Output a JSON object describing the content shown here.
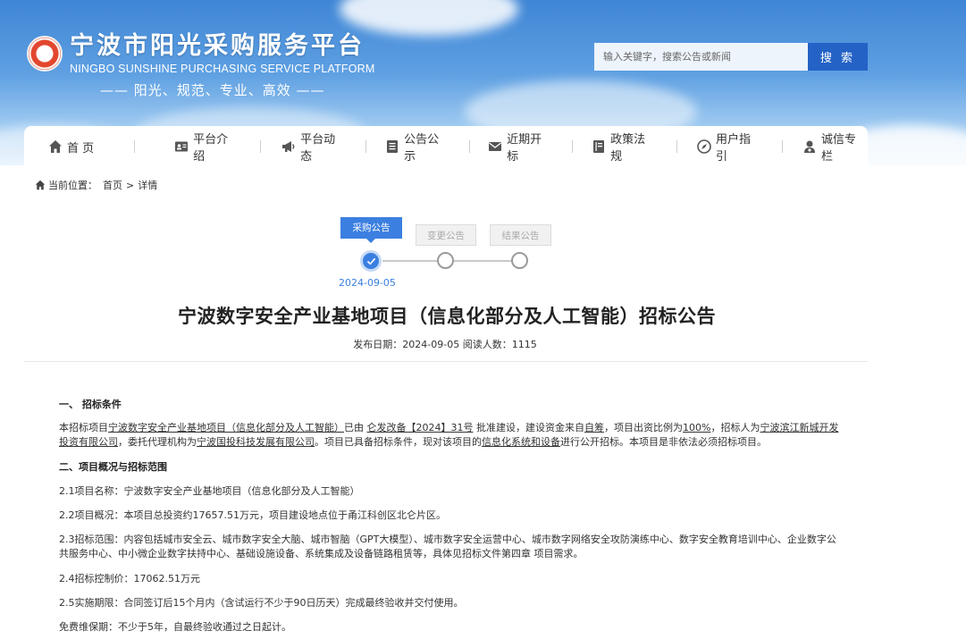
{
  "header": {
    "logo_cn": "宁波市阳光采购服务平台",
    "logo_en": "NINGBO SUNSHINE PURCHASING SERVICE PLATFORM",
    "slogan": "—— 阳光、规范、专业、高效 ——",
    "search": {
      "placeholder": "输入关键字，搜索公告或新闻",
      "button": "搜 索"
    }
  },
  "nav": {
    "items": [
      {
        "label": "首 页",
        "icon": "home-icon"
      },
      {
        "label": "平台介绍",
        "icon": "id-card-icon"
      },
      {
        "label": "平台动态",
        "icon": "megaphone-icon"
      },
      {
        "label": "公告公示",
        "icon": "list-doc-icon"
      },
      {
        "label": "近期开标",
        "icon": "envelope-icon"
      },
      {
        "label": "政策法规",
        "icon": "book-icon"
      },
      {
        "label": "用户指引",
        "icon": "compass-icon"
      },
      {
        "label": "诚信专栏",
        "icon": "person-badge-icon"
      }
    ]
  },
  "breadcrumb": {
    "prefix": "当前位置：",
    "home": "首页",
    "sep": ">",
    "current": "详情"
  },
  "steps": [
    {
      "label": "采购公告",
      "state": "active",
      "date": "2024-09-05"
    },
    {
      "label": "变更公告",
      "state": "inactive"
    },
    {
      "label": "结果公告",
      "state": "inactive"
    }
  ],
  "article": {
    "title": "宁波数字安全产业基地项目（信息化部分及人工智能）招标公告",
    "meta": "发布日期：2024-09-05 阅读人数：1115",
    "sections": {
      "s1_heading": "一、 招标条件",
      "s1_p1": {
        "t1": "本招标项目",
        "u1": "宁波数字安全产业基地项目（信息化部分及人工智能）",
        "t2": "已由",
        "u2": "仑发改备【2024】31号",
        "t3": "批准建设，建设资金来自",
        "u3": "自筹",
        "t4": "，项目出资比例为",
        "u4": "100%",
        "t5": "，招标人为",
        "u5": "宁波滨江新城开发投资有限公司",
        "t6": "，委托代理机构为",
        "u6": "宁波国投科技发展有限公司",
        "t7": "。项目已具备招标条件，现对该项目的",
        "u7": "信息化系统和设备",
        "t8": "进行公开招标。本项目是非依法必须招标项目。"
      },
      "s2_heading": "二、项目概况与招标范围",
      "s2_1": "2.1项目名称：宁波数字安全产业基地项目（信息化部分及人工智能）",
      "s2_2": "2.2项目概况：本项目总投资约17657.51万元，项目建设地点位于甬江科创区北仑片区。",
      "s2_3": "2.3招标范围：内容包括城市安全云、城市数字安全大脑、城市智脑（GPT大模型）、城市数字安全运营中心、城市数字网络安全攻防演练中心、数字安全教育培训中心、企业数字公共服务中心、中小微企业数字扶持中心、基础设施设备、系统集成及设备链路租赁等，具体见招标文件第四章 项目需求。",
      "s2_4": "2.4招标控制价：17062.51万元",
      "s2_5": "2.5实施期限：合同签订后15个月内（含试运行不少于90日历天）完成最终验收并交付使用。",
      "s2_6": "免费维保期：不少于5年，自最终验收通过之日起计。"
    }
  },
  "colors": {
    "primary": "#2462c6",
    "accent": "#3b7fe0",
    "banner_top": "#3f86d6"
  }
}
